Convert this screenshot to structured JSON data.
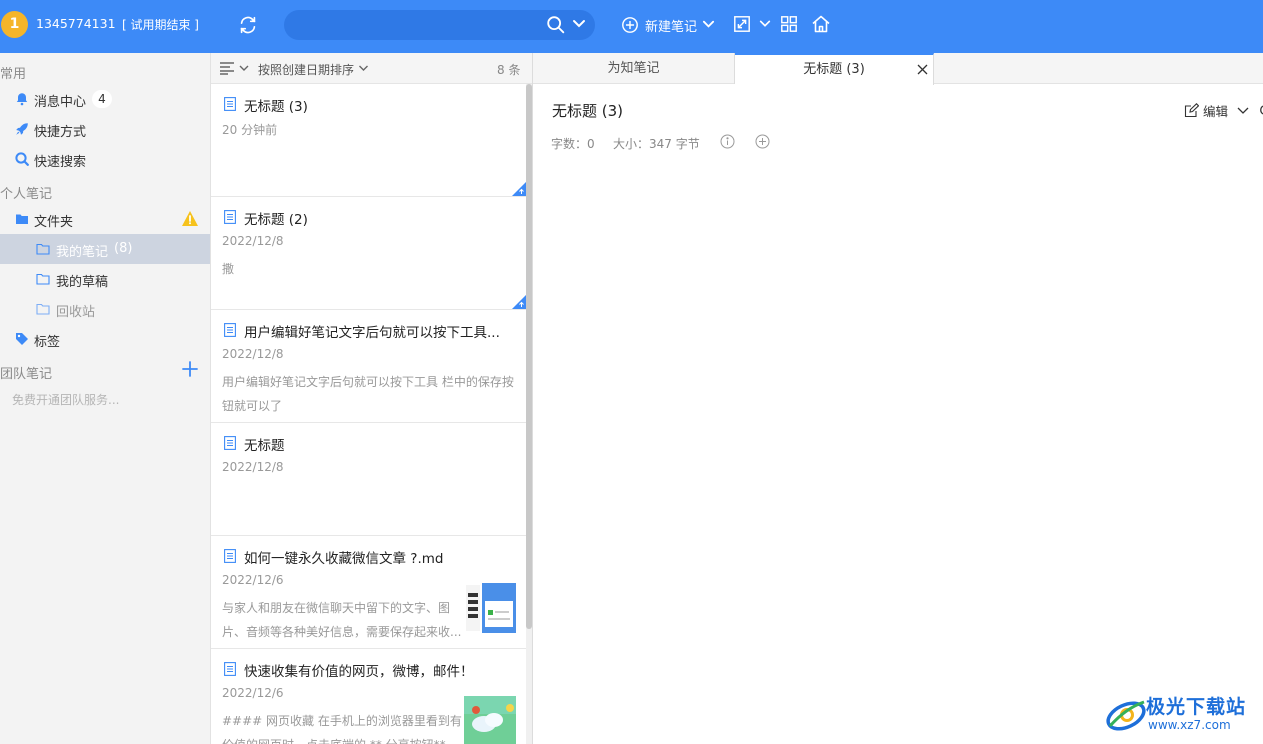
{
  "topbar": {
    "avatar_letter": "1",
    "username": "1345774131",
    "trial_status": "[ 试用期结束 ]",
    "new_note_label": "新建笔记",
    "brand_color": "#3d8af7"
  },
  "sidebar": {
    "common_title": "常用",
    "messages_label": "消息中心",
    "messages_count": "4",
    "shortcuts_label": "快捷方式",
    "quick_search_label": "快速搜索",
    "personal_title": "个人笔记",
    "folder_label": "文件夹",
    "my_notes_label": "我的笔记",
    "my_notes_count": "(8)",
    "drafts_label": "我的草稿",
    "recycle_label": "回收站",
    "tags_label": "标签",
    "team_title": "团队笔记",
    "team_free": "免费开通团队服务..."
  },
  "list": {
    "sort_label": "按照创建日期排序",
    "count": "8 条",
    "notes": [
      {
        "title": "无标题 (3)",
        "date": "20 分钟前",
        "snippet": ""
      },
      {
        "title": "无标题 (2)",
        "date": "2022/12/8",
        "snippet": "撒"
      },
      {
        "title": "用户编辑好笔记文字后句就可以按下工具...",
        "date": "2022/12/8",
        "snippet": "用户编辑好笔记文字后句就可以按下工具 栏中的保存按钮就可以了"
      },
      {
        "title": "无标题",
        "date": "2022/12/8",
        "snippet": ""
      },
      {
        "title": "如何一键永久收藏微信文章 ?.md",
        "date": "2022/12/6",
        "snippet": " 与家人和朋友在微信聊天中留下的文字、图片、音频等各种美好信息，需要保存起来收..."
      },
      {
        "title": "快速收集有价值的网页，微博，邮件！",
        "date": "2022/12/6",
        "snippet": " #### 网页收藏 在手机上的浏览器里看到有价值的网页时，点击底端的 ** 分享按钮** ..."
      }
    ]
  },
  "editor": {
    "tabs": [
      "为知笔记",
      "无标题 (3)"
    ],
    "doc_title": "无标题 (3)",
    "word_count": "字数：0",
    "size": "大小：347 字节",
    "edit_label": "编辑"
  },
  "watermark": {
    "name": "极光下载站",
    "url": "www.xz7.com"
  }
}
